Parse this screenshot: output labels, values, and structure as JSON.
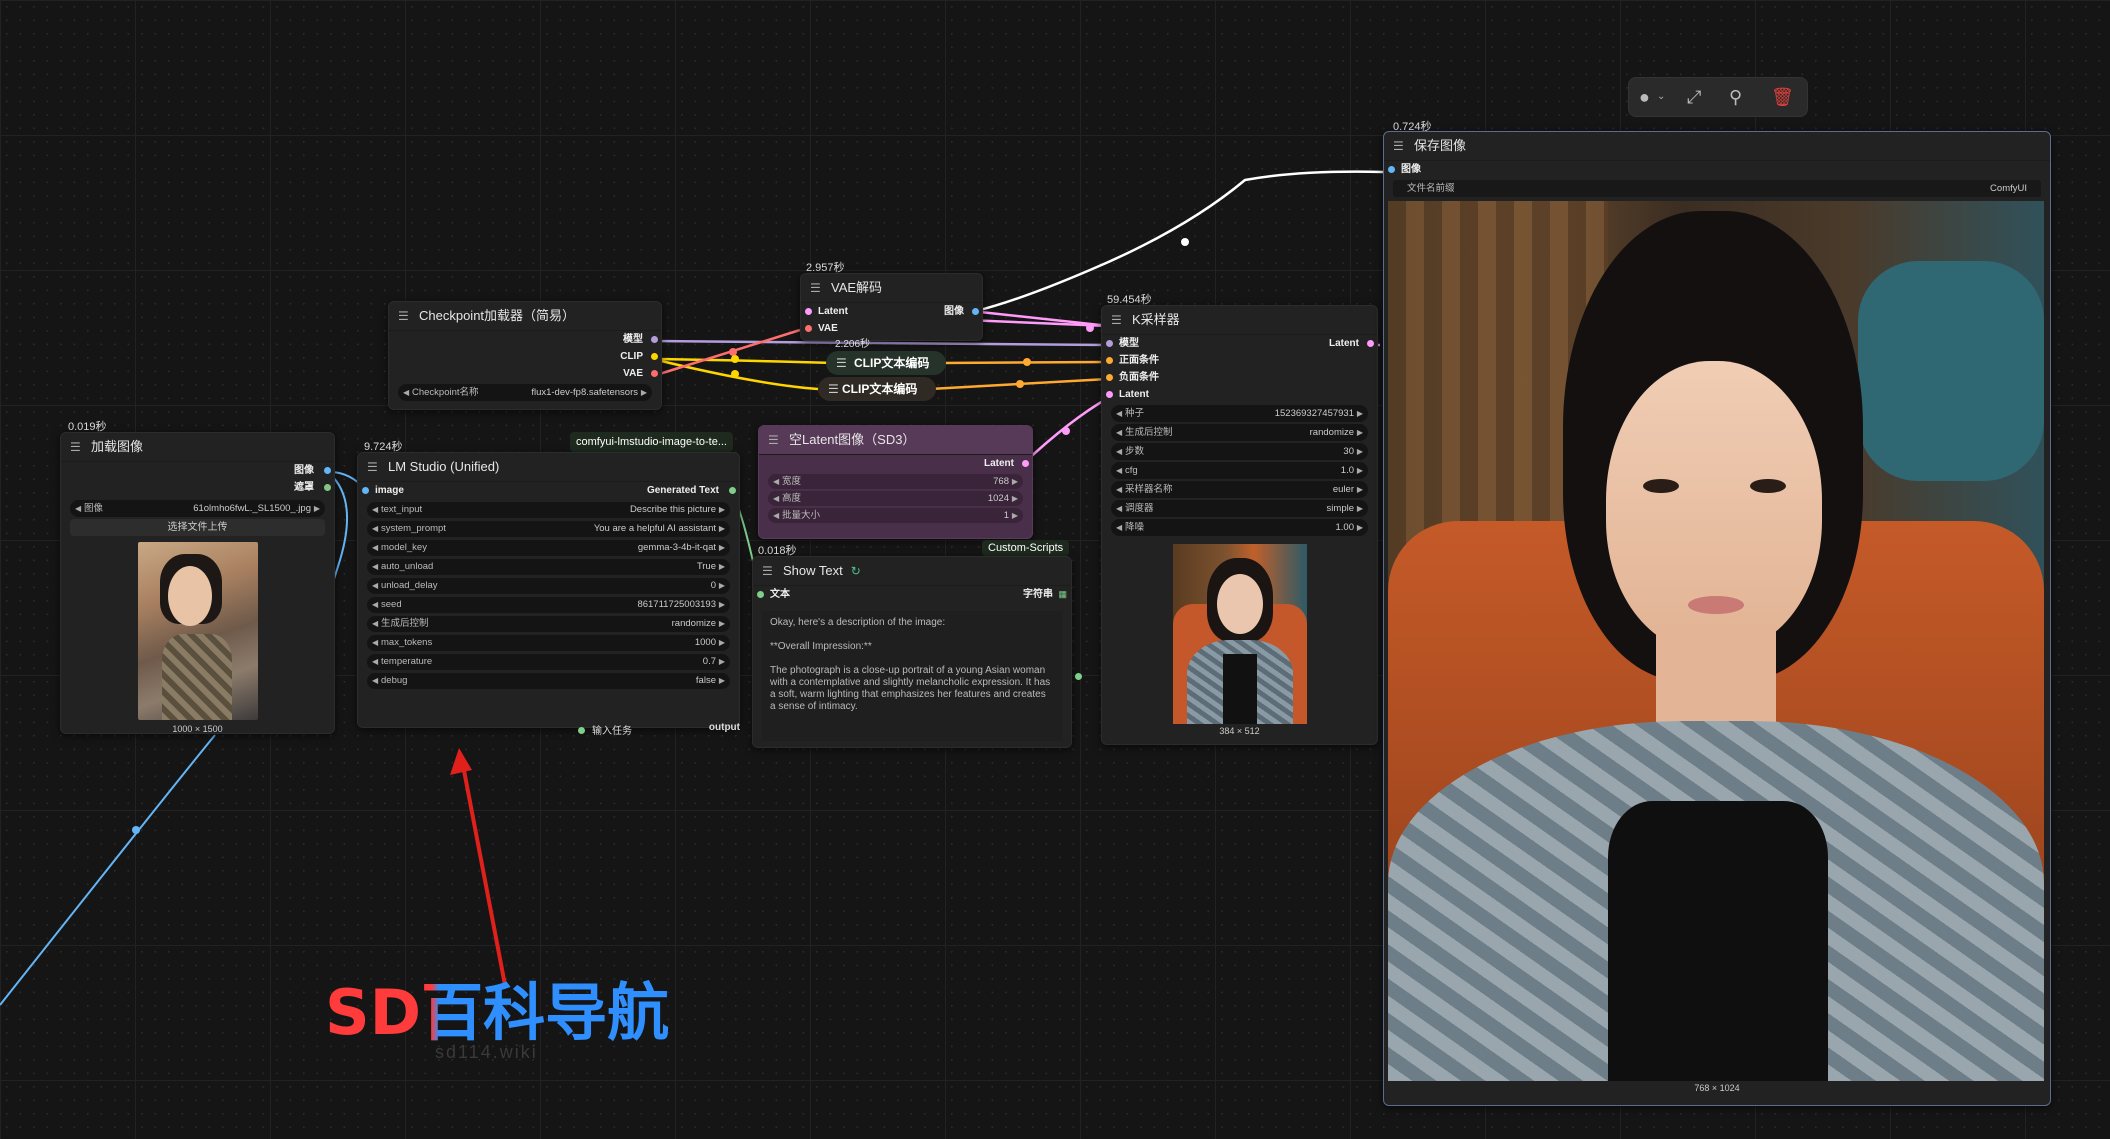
{
  "colors": {
    "model": "#b39ddb",
    "clip": "#ffd500",
    "vae": "#ff6e6e",
    "latent": "#ff9cf9",
    "image": "#64b5f6",
    "conditioning": "#ffa931",
    "mask": "#81c784",
    "string": "#7fcf8b",
    "wire_white": "#ffffff"
  },
  "toolbar": {
    "color_icon": "circle-icon",
    "bypass_icon": "wand-icon",
    "pin_icon": "pin-icon",
    "delete_icon": "trash-icon"
  },
  "load_image": {
    "timing": "0.019秒",
    "title": "加载图像",
    "out_image": "图像",
    "out_mask": "遮罩",
    "image_label": "图像",
    "image_value": "61olmho6fwL._SL1500_.jpg",
    "upload_btn": "选择文件上传",
    "size": "1000 × 1500"
  },
  "lm_studio": {
    "timing": "9.724秒",
    "title": "LM Studio (Unified)",
    "in_image": "image",
    "out_text": "Generated Text",
    "widgets": [
      {
        "label": "text_input",
        "value": "Describe this picture"
      },
      {
        "label": "system_prompt",
        "value": "You are a helpful AI assistant"
      },
      {
        "label": "model_key",
        "value": "gemma-3-4b-it-qat"
      },
      {
        "label": "auto_unload",
        "value": "True"
      },
      {
        "label": "unload_delay",
        "value": "0"
      },
      {
        "label": "seed",
        "value": "861711725003193"
      },
      {
        "label": "生成后控制",
        "value": "randomize"
      },
      {
        "label": "max_tokens",
        "value": "1000"
      },
      {
        "label": "temperature",
        "value": "0.7"
      },
      {
        "label": "debug",
        "value": "false"
      }
    ]
  },
  "group_tag": {
    "label": "comfyui-lmstudio-image-to-te..."
  },
  "checkpoint": {
    "title": "Checkpoint加载器（简易）",
    "out_model": "模型",
    "out_clip": "CLIP",
    "out_vae": "VAE",
    "widget_label": "Checkpoint名称",
    "widget_value": "flux1-dev-fp8.safetensors"
  },
  "vae_decode": {
    "timing": "2.957秒",
    "title": "VAE解码",
    "in_latent": "Latent",
    "in_vae": "VAE",
    "out_image": "图像"
  },
  "clip_encode_1": {
    "timing": "2.206秒",
    "title": "CLIP文本编码"
  },
  "clip_encode_2": {
    "title": "CLIP文本编码"
  },
  "empty_latent": {
    "title": "空Latent图像（SD3）",
    "out_latent": "Latent",
    "widgets": [
      {
        "label": "宽度",
        "value": "768"
      },
      {
        "label": "高度",
        "value": "1024"
      },
      {
        "label": "批量大小",
        "value": "1"
      }
    ]
  },
  "show_text": {
    "timing": "0.018秒",
    "badge": "Custom-Scripts",
    "title": "Show Text",
    "in_text": "文本",
    "out_string": "字符串",
    "lines": [
      "Okay, here's a description of the image:",
      "**Overall Impression:**",
      "The photograph is a close-up portrait of a young Asian woman with a contemplative and slightly melancholic expression. It has a soft, warm lighting that emphasizes her features and creates a sense of intimacy."
    ],
    "under_left": "输入任务",
    "under_right": "output"
  },
  "ksampler": {
    "timing": "59.454秒",
    "title": "K采样器",
    "in_model": "模型",
    "in_pos": "正面条件",
    "in_neg": "负面条件",
    "in_latent": "Latent",
    "out_latent": "Latent",
    "widgets": [
      {
        "label": "种子",
        "value": "152369327457931"
      },
      {
        "label": "生成后控制",
        "value": "randomize"
      },
      {
        "label": "步数",
        "value": "30"
      },
      {
        "label": "cfg",
        "value": "1.0"
      },
      {
        "label": "采样器名称",
        "value": "euler"
      },
      {
        "label": "调度器",
        "value": "simple"
      },
      {
        "label": "降噪",
        "value": "1.00"
      }
    ],
    "size": "384 × 512"
  },
  "save_image": {
    "timing": "0.724秒",
    "title": "保存图像",
    "in_image": "图像",
    "prefix_label": "文件名前缀",
    "prefix_value": "ComfyUI",
    "size": "768 × 1024"
  },
  "watermark": {
    "text": "SD百科导航",
    "sub": "sd114.wiki"
  }
}
